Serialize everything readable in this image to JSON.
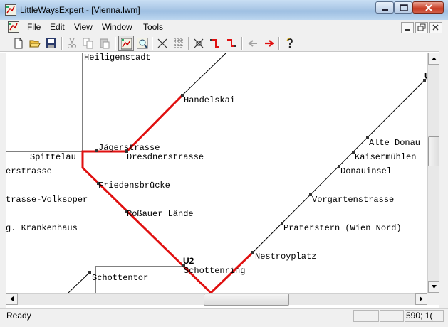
{
  "window": {
    "title": "LittleWaysExpert - [Vienna.lwm]"
  },
  "menu": {
    "items": [
      {
        "label": "File",
        "accel": "F",
        "rest": "ile"
      },
      {
        "label": "Edit",
        "accel": "E",
        "rest": "dit"
      },
      {
        "label": "View",
        "accel": "V",
        "rest": "iew"
      },
      {
        "label": "Window",
        "accel": "W",
        "rest": "indow"
      },
      {
        "label": "Tools",
        "accel": "T",
        "rest": "ools"
      }
    ]
  },
  "toolbar": {
    "buttons": [
      "new-icon",
      "open-icon",
      "save-icon",
      "cut-icon",
      "copy-icon",
      "paste-icon",
      "select-route-icon",
      "zoom-route-icon",
      "delete-line-icon",
      "grid-icon",
      "delete-node-icon",
      "route-icon",
      "route-alt-icon",
      "back-arrow-icon",
      "forward-arrow-icon",
      "help-icon"
    ],
    "colors": {
      "route": "#e01010",
      "arrow_active": "#e01010",
      "arrow_inactive": "#a0a0a0"
    }
  },
  "map": {
    "route_color": "#e01010",
    "line_color": "#000000",
    "stations": {
      "heiligenstadt": "Heiligenstadt",
      "handelskai": "Handelskai",
      "jaegerstrasse": "Jägerstrasse",
      "spittelau": "Spittelau",
      "dresdnerstrasse": "Dresdnerstrasse",
      "erstrasse": "erstrasse",
      "friedensbruecke": "Friedensbrücke",
      "volksoper": "trasse-Volksoper",
      "rossauer": "Roßauer Lände",
      "krankenhaus": "g. Krankenhaus",
      "schottenring": "Schottenring",
      "schottentor": "Schottentor",
      "alte_donau": "Alte Donau",
      "kaisermuehlen": "Kaisermühlen",
      "donauinsel": "Donauinsel",
      "vorgartenstrasse": "Vorgartenstrasse",
      "praterstern": "Praterstern (Wien Nord)",
      "nestroyplatz": "Nestroyplatz"
    },
    "line_labels": {
      "u2": "U2",
      "u1": "U"
    }
  },
  "status": {
    "text": "Ready",
    "coords": "590; 1("
  }
}
